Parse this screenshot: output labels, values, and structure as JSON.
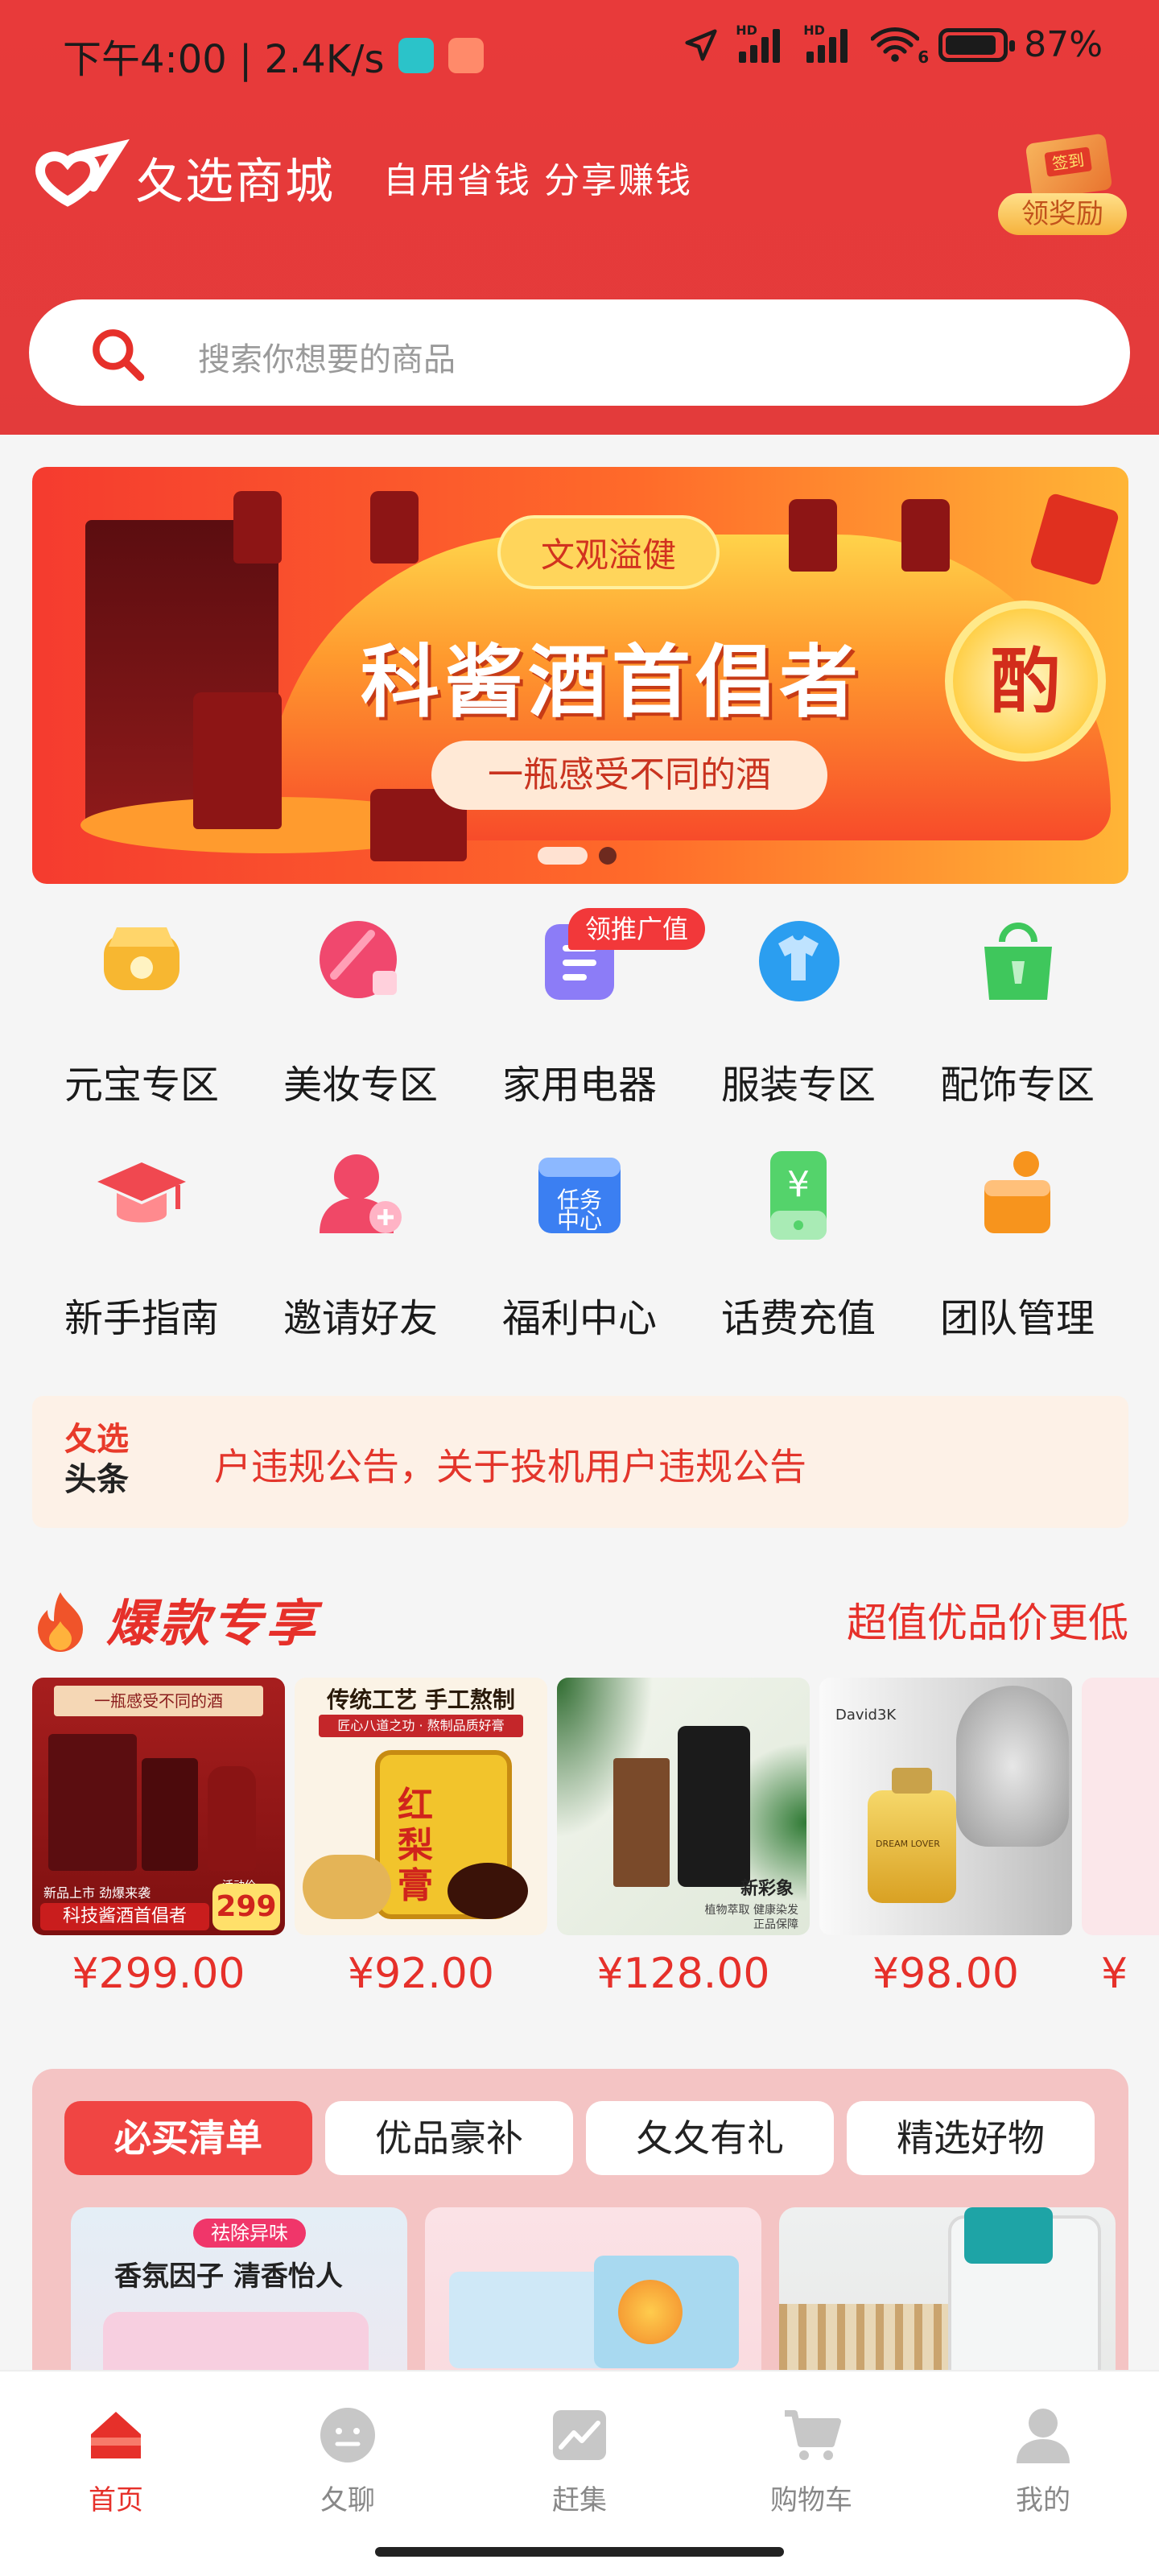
{
  "status_bar": {
    "time_speed": "下午4:00 | 2.4K/s",
    "battery": "87%",
    "net_a": "HD",
    "net_b": "HD",
    "wifi_num": "6"
  },
  "header": {
    "brand": "�act选商城",
    "slogan": "自用省钱 分享赚钱",
    "reward_label": "领奖励",
    "reward_box": "签到"
  },
  "search": {
    "placeholder": "搜索你想要的商品"
  },
  "banner": {
    "tag": "文观溢健",
    "title": "科酱酒首倡者",
    "subtitle": "一瓶感受不同的酒",
    "seal": "酌"
  },
  "categories": [
    {
      "label": "元宝专区",
      "icon": "ingot-icon",
      "color": "#f7b731"
    },
    {
      "label": "美妆专区",
      "icon": "cosmetics-icon",
      "color": "#f0486e"
    },
    {
      "label": "家用电器",
      "icon": "appliance-icon",
      "color": "#8c7cf7"
    },
    {
      "label": "服装专区",
      "icon": "clothing-icon",
      "color": "#2b9ef0"
    },
    {
      "label": "配饰专区",
      "icon": "bag-icon",
      "color": "#3fc75c"
    },
    {
      "label": "新手指南",
      "icon": "graduation-cap-icon",
      "color": "#f04850"
    },
    {
      "label": "邀请好友",
      "icon": "invite-friend-icon",
      "color": "#f04867"
    },
    {
      "label": "福利中心",
      "icon": "task-center-icon",
      "color": "#3b7ff2",
      "badge": "领推广值",
      "icon_text": "任务中心"
    },
    {
      "label": "话费充值",
      "icon": "phone-recharge-icon",
      "color": "#54d36b",
      "icon_text": "¥"
    },
    {
      "label": "团队管理",
      "icon": "team-icon",
      "color": "#f7941d"
    }
  ],
  "notice": {
    "brand_top": "夂选",
    "brand_bottom": "头条",
    "text": "户违规公告，关于投机用户违规公告"
  },
  "hot": {
    "title": "爆款专享",
    "more": "超值优品价更低"
  },
  "products": [
    {
      "price": "¥299.00",
      "caption": "一瓶感受不同的酒",
      "footer": "科技酱酒首倡者",
      "tag": "299",
      "tag_label": "活动价",
      "sub": "新品上市 劲爆来袭"
    },
    {
      "price": "¥92.00",
      "caption": "传统工艺 手工熬制",
      "sub": "匠心八道之功 · 熬制品质好膏",
      "footer": "红梨膏"
    },
    {
      "price": "¥128.00",
      "caption": "新彩象",
      "sub": "植物萃取 健康染发",
      "footer": "正品保障"
    },
    {
      "price": "¥98.00",
      "caption": "David3K",
      "sub": "DREAM LOVER"
    },
    {
      "price": "¥"
    }
  ],
  "must_buy": {
    "tabs": [
      "必买清单",
      "优品豪补",
      "夂夂有礼",
      "精选好物"
    ],
    "card1_tag": "祛除异味",
    "card1_title": "香氛因子 清香怡人"
  },
  "tabbar": [
    {
      "label": "首页",
      "icon": "home-icon",
      "active": true
    },
    {
      "label": "夂聊",
      "icon": "chat-face-icon",
      "active": false
    },
    {
      "label": "赶集",
      "icon": "market-chart-icon",
      "active": false
    },
    {
      "label": "购物车",
      "icon": "cart-icon",
      "active": false
    },
    {
      "label": "我的",
      "icon": "profile-icon",
      "active": false
    }
  ]
}
